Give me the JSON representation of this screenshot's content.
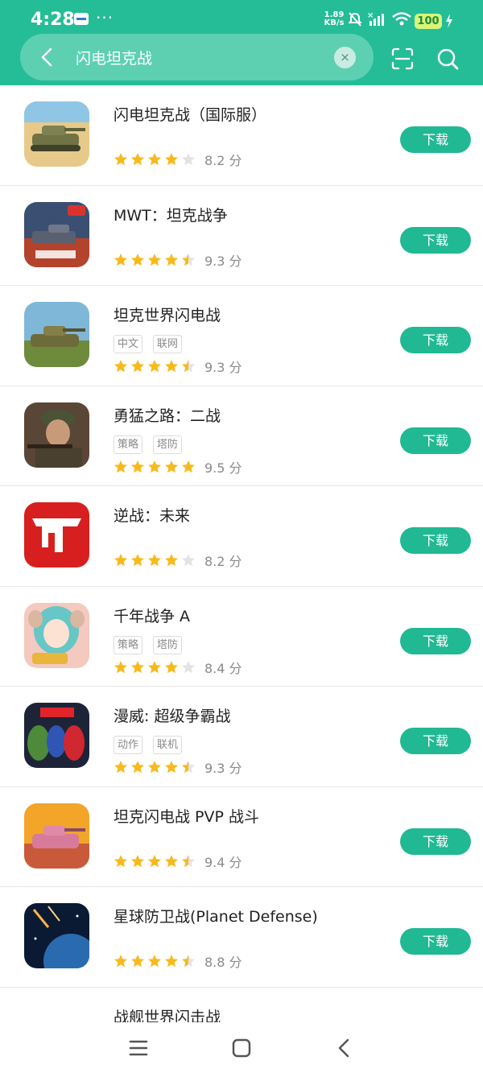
{
  "status_bar": {
    "time": "4:28",
    "dots": "···",
    "net_speed_value": "1.89",
    "net_speed_unit": "KB/s",
    "battery": "100"
  },
  "search": {
    "query": "闪电坦克战",
    "clear_label": "×"
  },
  "colors": {
    "header": "#25bd98",
    "accent": "#20b993",
    "star": "#f8b91b"
  },
  "apps": [
    {
      "name": "闪电坦克战（国际服）",
      "tags": [],
      "stars": 4,
      "score": "8.2 分",
      "download": "下载"
    },
    {
      "name": "MWT：坦克战争",
      "tags": [],
      "stars": 4.5,
      "score": "9.3 分",
      "download": "下载"
    },
    {
      "name": "坦克世界闪电战",
      "tags": [
        "中文",
        "联网"
      ],
      "stars": 4.5,
      "score": "9.3 分",
      "download": "下载"
    },
    {
      "name": "勇猛之路：二战",
      "tags": [
        "策略",
        "塔防"
      ],
      "stars": 5,
      "score": "9.5 分",
      "download": "下载"
    },
    {
      "name": "逆战：未来",
      "tags": [],
      "stars": 4,
      "score": "8.2 分",
      "download": "下载"
    },
    {
      "name": "千年战争 A",
      "tags": [
        "策略",
        "塔防"
      ],
      "stars": 4,
      "score": "8.4 分",
      "download": "下载"
    },
    {
      "name": "漫威: 超级争霸战",
      "tags": [
        "动作",
        "联机"
      ],
      "stars": 4.5,
      "score": "9.3 分",
      "download": "下载"
    },
    {
      "name": "坦克闪电战 PVP 战斗",
      "tags": [],
      "stars": 4.5,
      "score": "9.4 分",
      "download": "下载"
    },
    {
      "name": "星球防卫战(Planet Defense)",
      "tags": [],
      "stars": 4.5,
      "score": "8.8 分",
      "download": "下载"
    },
    {
      "name": "战舰世界闪击战",
      "tags": [],
      "stars": 0,
      "score": "",
      "download": ""
    }
  ]
}
